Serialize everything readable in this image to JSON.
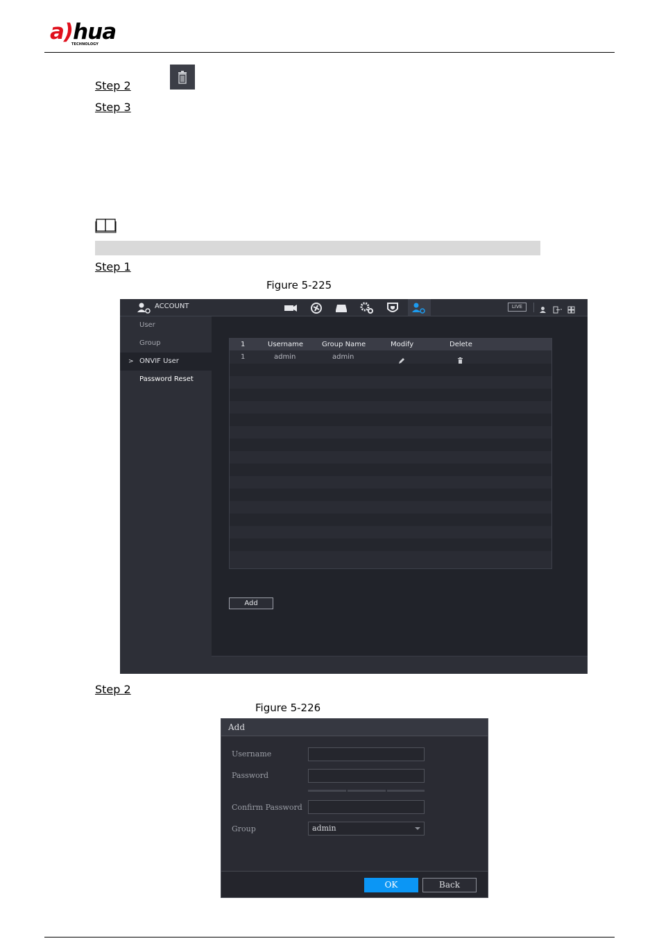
{
  "header": {
    "logo_main": "a",
    "logo_hua": "hua",
    "logo_sub": "TECHNOLOGY"
  },
  "steps": {
    "step2_top": "Step 2",
    "step3": "Step 3",
    "step1": "Step 1",
    "step2_bottom": "Step 2"
  },
  "figures": {
    "fig1": "Figure 5-225",
    "fig2": "Figure 5-226"
  },
  "shot1": {
    "title": "ACCOUNT",
    "live": "LIVE",
    "sidebar": [
      {
        "label": "User"
      },
      {
        "label": "Group"
      },
      {
        "label": "ONVIF User"
      },
      {
        "label": "Password Reset"
      }
    ],
    "table": {
      "headers": [
        "1",
        "Username",
        "Group Name",
        "Modify",
        "Delete"
      ],
      "rows": [
        {
          "index": "1",
          "username": "admin",
          "group": "admin"
        }
      ]
    },
    "add_label": "Add"
  },
  "shot2": {
    "title": "Add",
    "username_label": "Username",
    "password_label": "Password",
    "confirm_label": "Confirm Password",
    "group_label": "Group",
    "group_value": "admin",
    "ok_label": "OK",
    "back_label": "Back"
  },
  "colors": {
    "brand_red": "#e0101c",
    "ui_accent": "#0b96f5",
    "ui_bg": "#21232a"
  }
}
